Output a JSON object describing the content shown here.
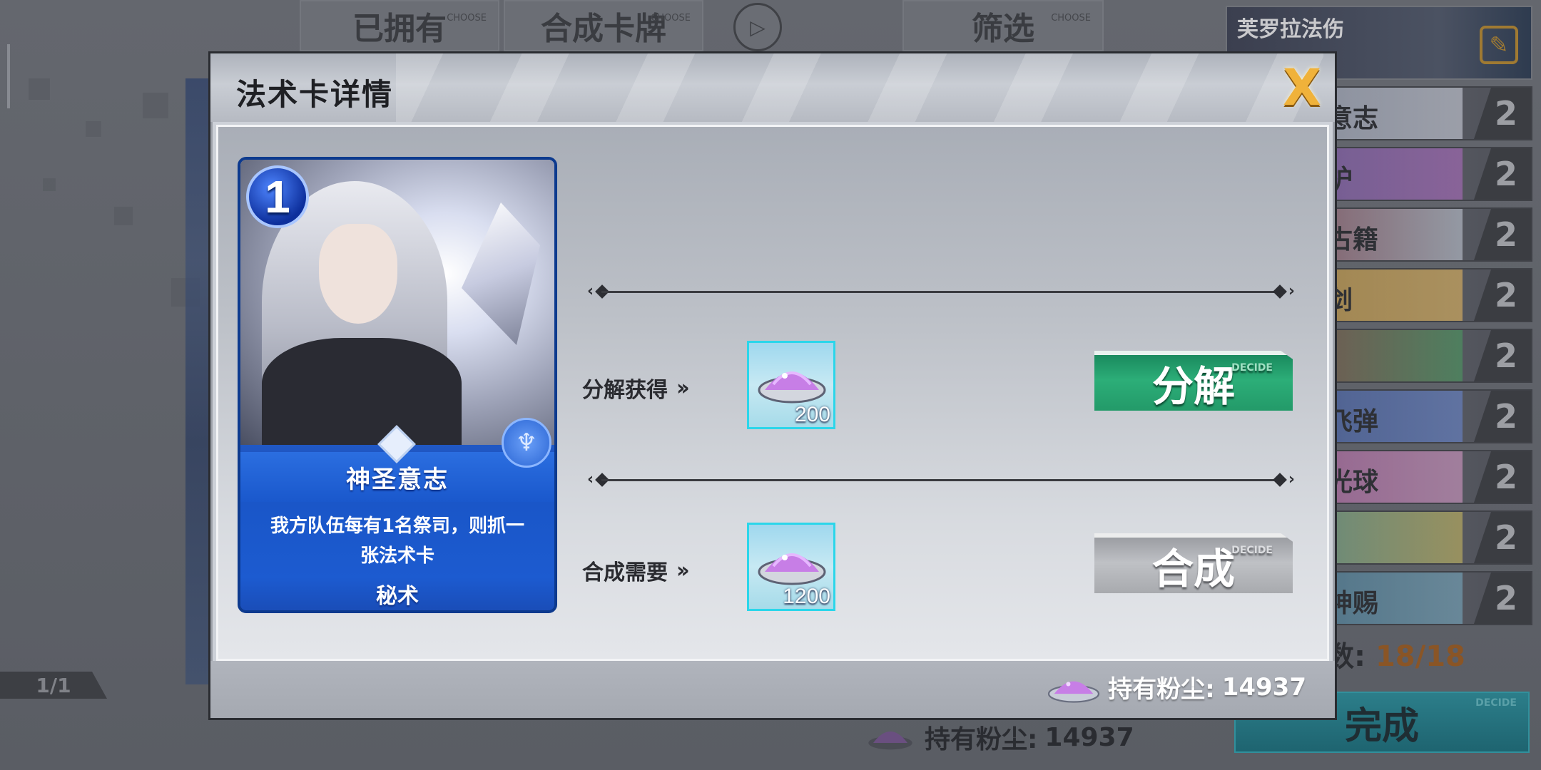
{
  "background": {
    "tabs": {
      "owned": "已拥有",
      "craft": "合成卡牌",
      "filter": "筛选",
      "choose_tag": "CHOOSE"
    },
    "play_icon": "play-icon",
    "page_indicator": "1/1",
    "deck": {
      "title": "芙罗拉法伤",
      "edit_icon": "edit-icon",
      "rows": [
        {
          "name": "意志",
          "count": "2"
        },
        {
          "name": "护",
          "count": "2"
        },
        {
          "name": "古籍",
          "count": "2"
        },
        {
          "name": "剑",
          "count": "2"
        },
        {
          "name": "",
          "count": "2"
        },
        {
          "name": "飞弹",
          "count": "2"
        },
        {
          "name": "光球",
          "count": "2"
        },
        {
          "name": "",
          "count": "2"
        },
        {
          "name": "神赐",
          "count": "2"
        }
      ],
      "count_label": "数:",
      "count_value": "18/18",
      "done_label": "完成",
      "decide_tag": "DECIDE"
    },
    "dust_label": "持有粉尘:",
    "dust_value": "14937"
  },
  "modal": {
    "title": "法术卡详情",
    "close_icon": "close-icon",
    "close_label": "X",
    "card": {
      "cost": "1",
      "name": "神圣意志",
      "description": "我方队伍每有1名祭司，则抓一张法术卡",
      "type": "秘术",
      "class_icon": "priest-class-icon"
    },
    "disenchant": {
      "label": "分解获得",
      "amount": "200",
      "button": "分解",
      "decide_tag": "DECIDE"
    },
    "craft": {
      "label": "合成需要",
      "amount": "1200",
      "button": "合成",
      "decide_tag": "DECIDE"
    },
    "footer": {
      "dust_label": "持有粉尘:",
      "dust_value": "14937"
    }
  },
  "colors": {
    "accent_gold": "#f0b23a",
    "disenchant_green": "#2cae78",
    "craft_gray": "#bfc1c5",
    "card_blue": "#1a58cc",
    "dust_tile_border": "#2bd6ea"
  }
}
